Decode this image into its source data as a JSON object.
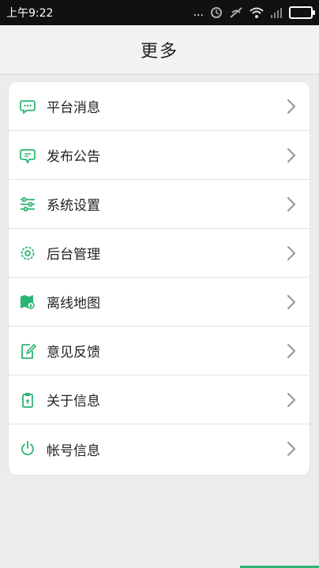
{
  "status_bar": {
    "time": "上午9:22",
    "dots": "..."
  },
  "header": {
    "title": "更多"
  },
  "menu": {
    "items": [
      {
        "label": "平台消息",
        "icon": "chat-bubble-icon"
      },
      {
        "label": "发布公告",
        "icon": "announcement-icon"
      },
      {
        "label": "系统设置",
        "icon": "sliders-icon"
      },
      {
        "label": "后台管理",
        "icon": "gear-icon"
      },
      {
        "label": "离线地图",
        "icon": "map-icon"
      },
      {
        "label": "意见反馈",
        "icon": "edit-note-icon"
      },
      {
        "label": "关于信息",
        "icon": "clipboard-icon"
      },
      {
        "label": "帐号信息",
        "icon": "power-icon"
      }
    ]
  },
  "colors": {
    "accent": "#2bb673",
    "chevron": "#999999"
  }
}
